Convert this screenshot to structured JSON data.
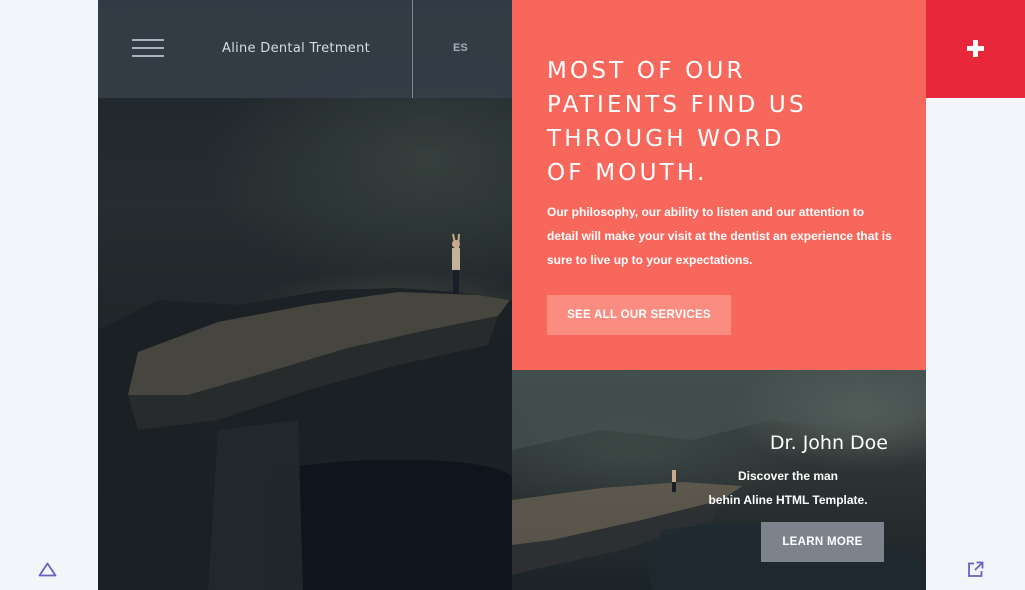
{
  "header": {
    "brand": "Aline Dental Tretment",
    "language": "ES",
    "menu_icon": "hamburger-menu-icon"
  },
  "hero": {
    "headline_lines": [
      "MOST OF OUR",
      "PATIENTS FIND US",
      "THROUGH WORD",
      "OF MOUTH."
    ],
    "intro": "Our philosophy, our ability to listen and our attention to detail will make your visit at the dentist an experience that is sure to live up to your expectations.",
    "cta_label": "SEE ALL OUR SERVICES"
  },
  "plus_tile": {
    "icon": "plus-icon"
  },
  "doctor_card": {
    "name": "Dr. John Doe",
    "desc_lines": [
      "Discover the man",
      "behin Aline HTML Template."
    ],
    "cta_label": "LEARN MORE"
  },
  "corner_icons": {
    "left": "triangle-up-icon",
    "right": "external-link-icon"
  },
  "colors": {
    "coral": "#f8675b",
    "coral_button": "#fb8c80",
    "red_tile": "#e8273a",
    "topbar": "#343e48",
    "grey_button": "#7c838c",
    "accent_icon": "#6b5fc7",
    "page_bg": "#f4f5fa"
  }
}
